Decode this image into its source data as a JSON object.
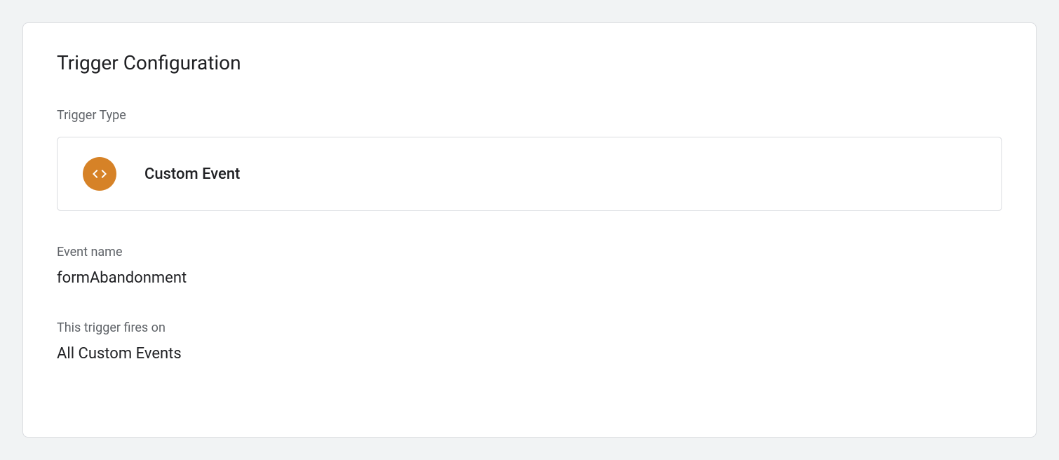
{
  "card": {
    "title": "Trigger Configuration",
    "triggerType": {
      "label": "Trigger Type",
      "iconName": "code-icon",
      "name": "Custom Event"
    },
    "eventName": {
      "label": "Event name",
      "value": "formAbandonment"
    },
    "firesOn": {
      "label": "This trigger fires on",
      "value": "All Custom Events"
    }
  }
}
